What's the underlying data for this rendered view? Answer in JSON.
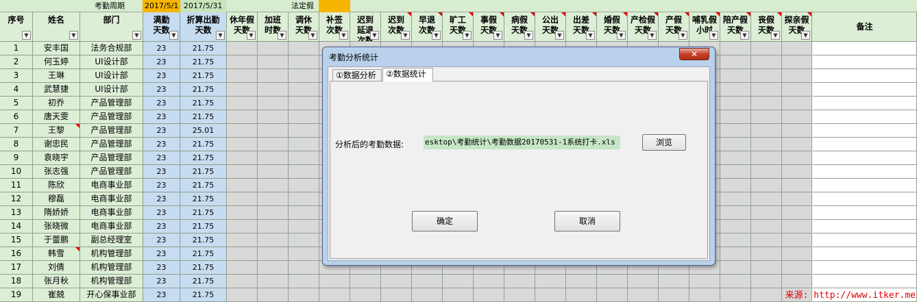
{
  "top_row": {
    "period_label": "考勤周期",
    "start_date": "2017/5/1",
    "end_date": "2017/5/31",
    "holiday_label": "法定假"
  },
  "headers": [
    "序号",
    "姓名",
    "部门",
    "满勤\n天数",
    "折算出勤\n天数",
    "休年假\n天数",
    "加班\n时数",
    "调休\n天数",
    "补签\n次数",
    "迟到\n延退\n次数",
    "迟到\n次数",
    "早退\n次数",
    "旷工\n天数",
    "事假\n天数",
    "病假\n天数",
    "公出\n天数",
    "出差\n天数",
    "婚假\n天数",
    "产检假\n天数",
    "产假\n天数",
    "哺乳假\n小时",
    "陪产假\n天数",
    "丧假\n天数",
    "探亲假\n天数",
    "备注"
  ],
  "rows": [
    {
      "no": "1",
      "name": "安丰国",
      "dept": "法务合规部",
      "full": "23",
      "actual": "21.75"
    },
    {
      "no": "2",
      "name": "何玉婷",
      "dept": "UI设计部",
      "full": "23",
      "actual": "21.75"
    },
    {
      "no": "3",
      "name": "王琳",
      "dept": "UI设计部",
      "full": "23",
      "actual": "21.75"
    },
    {
      "no": "4",
      "name": "武慧捷",
      "dept": "UI设计部",
      "full": "23",
      "actual": "21.75"
    },
    {
      "no": "5",
      "name": "初乔",
      "dept": "产品管理部",
      "full": "23",
      "actual": "21.75"
    },
    {
      "no": "6",
      "name": "唐天雯",
      "dept": "产品管理部",
      "full": "23",
      "actual": "21.75"
    },
    {
      "no": "7",
      "name": "王黎",
      "dept": "产品管理部",
      "full": "23",
      "actual": "25.01"
    },
    {
      "no": "8",
      "name": "谢忠民",
      "dept": "产品管理部",
      "full": "23",
      "actual": "21.75"
    },
    {
      "no": "9",
      "name": "袁晓宇",
      "dept": "产品管理部",
      "full": "23",
      "actual": "21.75"
    },
    {
      "no": "10",
      "name": "张志强",
      "dept": "产品管理部",
      "full": "23",
      "actual": "21.75"
    },
    {
      "no": "11",
      "name": "陈欣",
      "dept": "电商事业部",
      "full": "23",
      "actual": "21.75"
    },
    {
      "no": "12",
      "name": "穆磊",
      "dept": "电商事业部",
      "full": "23",
      "actual": "21.75"
    },
    {
      "no": "13",
      "name": "隋娇娇",
      "dept": "电商事业部",
      "full": "23",
      "actual": "21.75"
    },
    {
      "no": "14",
      "name": "张晓微",
      "dept": "电商事业部",
      "full": "23",
      "actual": "21.75"
    },
    {
      "no": "15",
      "name": "于蕾鹏",
      "dept": "副总经理室",
      "full": "23",
      "actual": "21.75"
    },
    {
      "no": "16",
      "name": "韩雪",
      "dept": "机构管理部",
      "full": "23",
      "actual": "21.75"
    },
    {
      "no": "17",
      "name": "刘倩",
      "dept": "机构管理部",
      "full": "23",
      "actual": "21.75"
    },
    {
      "no": "18",
      "name": "张月秋",
      "dept": "机构管理部",
      "full": "23",
      "actual": "21.75"
    },
    {
      "no": "19",
      "name": "崔兢",
      "dept": "开心保事业部",
      "full": "23",
      "actual": "21.75"
    }
  ],
  "dialog": {
    "title": "考勤分析统计",
    "close_label": "✕",
    "tabs": [
      "①数据分析",
      "②数据统计"
    ],
    "active_tab": "②数据统计",
    "data_label": "分析后的考勤数据:",
    "data_path": "esktop\\考勤统计\\考勤数据20170531-1系统打卡.xls",
    "browse_label": "浏览",
    "ok_label": "确定",
    "cancel_label": "取消"
  },
  "source_text": "来源: http://www.itker.me",
  "colors": {
    "header_green": "#ddeed6",
    "blue_column": "#c6dcf0",
    "gray_cell": "#d9d9d9",
    "top_orange": "#f7b400",
    "dialog_frame": "#b9d1ea",
    "path_field": "#c6e6c6",
    "source_red": "#e00000"
  }
}
